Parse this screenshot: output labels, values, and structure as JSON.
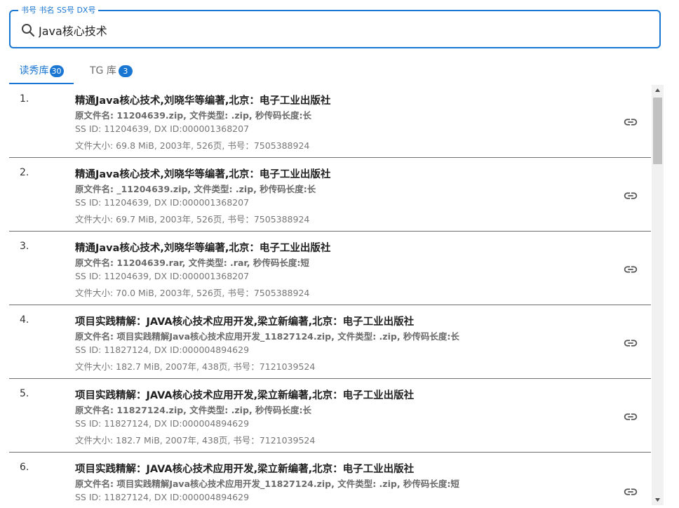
{
  "search": {
    "label": "书号 书名 SS号 DX号",
    "value": "Java核心技术"
  },
  "tabs": [
    {
      "label": "读秀库",
      "count": "30",
      "active": true
    },
    {
      "label": "TG 库",
      "count": "3",
      "active": false
    }
  ],
  "results": [
    {
      "index": "1.",
      "title": "精通Java核心技术,刘晓华等编著,北京：电子工业出版社",
      "file": "原文件名: 11204639.zip, 文件类型: .zip, 秒传码长度:长",
      "ids": "SS ID: 11204639, DX ID:000001368207",
      "meta": "文件大小: 69.8 MiB, 2003年, 526页, 书号：7505388924"
    },
    {
      "index": "2.",
      "title": "精通Java核心技术,刘晓华等编著,北京：电子工业出版社",
      "file": "原文件名: _11204639.zip, 文件类型: .zip, 秒传码长度:长",
      "ids": "SS ID: 11204639, DX ID:000001368207",
      "meta": "文件大小: 69.7 MiB, 2003年, 526页, 书号：7505388924"
    },
    {
      "index": "3.",
      "title": "精通Java核心技术,刘晓华等编著,北京：电子工业出版社",
      "file": "原文件名: 11204639.rar, 文件类型: .rar, 秒传码长度:短",
      "ids": "SS ID: 11204639, DX ID:000001368207",
      "meta": "文件大小: 70.0 MiB, 2003年, 526页, 书号：7505388924"
    },
    {
      "index": "4.",
      "title": "项目实践精解：JAVA核心技术应用开发,梁立新编著,北京：电子工业出版社",
      "file": "原文件名: 项目实践精解Java核心技术应用开发_11827124.zip, 文件类型: .zip, 秒传码长度:长",
      "ids": "SS ID: 11827124, DX ID:000004894629",
      "meta": "文件大小: 182.7 MiB, 2007年, 438页, 书号：7121039524"
    },
    {
      "index": "5.",
      "title": "项目实践精解：JAVA核心技术应用开发,梁立新编著,北京：电子工业出版社",
      "file": "原文件名: 11827124.zip, 文件类型: .zip, 秒传码长度:长",
      "ids": "SS ID: 11827124, DX ID:000004894629",
      "meta": "文件大小: 182.7 MiB, 2007年, 438页, 书号：7121039524"
    },
    {
      "index": "6.",
      "title": "项目实践精解：JAVA核心技术应用开发,梁立新编著,北京：电子工业出版社",
      "file": "原文件名: 项目实践精解Java核心技术应用开发_11827124.zip, 文件类型: .zip, 秒传码长度:短",
      "ids": "SS ID: 11827124, DX ID:000004894629",
      "meta": ""
    }
  ],
  "icons": {
    "search": "search-icon",
    "link": "link-icon",
    "scroll_up": "chevron-up-icon",
    "scroll_down": "chevron-down-icon"
  },
  "colors": {
    "accent": "#1976d2",
    "badge_text": "#ffffff",
    "divider": "#6e6e6e"
  }
}
